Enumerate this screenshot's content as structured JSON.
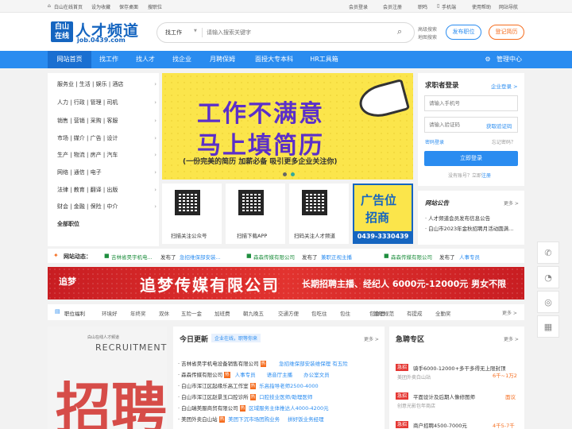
{
  "topbar": {
    "site_link": "白山在线首页",
    "bookmark": "设为收藏",
    "save_desktop": "保存桌面",
    "search_pos": "搜职位",
    "member_login": "会员登录",
    "member_register": "会员注册",
    "recruit": "职鸣",
    "mobile": "手机端",
    "help": "使用帮助",
    "site_nav": "网站导航"
  },
  "header": {
    "logo_top": "白山",
    "logo_bottom": "在线",
    "logo_title": "人才频道",
    "logo_url": "job.0439.com",
    "search_type": "找工作",
    "search_placeholder": "请输入搜索关键字",
    "adv_search": "高级搜索",
    "map_search": "地图搜索",
    "post_job": "发布职位",
    "register_resume": "登记简历"
  },
  "nav": {
    "items": [
      "网站首页",
      "找工作",
      "找人才",
      "找企业",
      "月聘保姆",
      "面授大专本科",
      "HR工具箱"
    ],
    "admin": "管理中心"
  },
  "categories": [
    "服务业 | 生活 | 娱乐 | 酒店",
    "人力 | 行政 | 管理 | 司机",
    "销售 | 营销 | 采购 | 客服",
    "市场 | 媒介 | 广告 | 设计",
    "生产 | 物流 | 房产 | 汽车",
    "网络 | 通信 | 电子",
    "法律 | 教育 | 翻译 | 出版",
    "财会 | 金融 | 保险 | 中介",
    "全部职位"
  ],
  "banner": {
    "line1": "工作不满意",
    "line2": "马上填简历",
    "line3": "(一份完美的简历 加薪必备 吸引更多企业关注你)"
  },
  "qrs": [
    {
      "caption": "扫描关注公众号"
    },
    {
      "caption": "扫描下载APP"
    },
    {
      "caption": "扫码关注人才频道"
    }
  ],
  "ad": {
    "line1": "广告位",
    "line2": "招商",
    "phone": "0439-3330439"
  },
  "login": {
    "title": "求职者登录",
    "company_login": "企业登录 >",
    "phone_placeholder": "请输入手机号",
    "code_placeholder": "请输入验证码",
    "get_code": "获取验证码",
    "password_login": "密码登录",
    "forgot": "忘记密码？",
    "submit": "立即登录",
    "no_account": "没有账号？立即",
    "register": "注册"
  },
  "notice": {
    "title": "网站公告",
    "more": "更多 >",
    "items": [
      "· 人才频道会员发布信息公告",
      "· 白山市2023年金秋招聘月活动圆满..."
    ]
  },
  "dynamics": {
    "label": "网站动态：",
    "items": [
      {
        "company": "吉林省昊宇机电...",
        "job": "急招维保部安装..."
      },
      {
        "company": "森森传媒有限公司",
        "job": "兼职正视主播"
      },
      {
        "company": "森森传媒有限公司",
        "job": "人事专员"
      }
    ],
    "published": "发布了"
  },
  "wide_banner": {
    "brand": "追梦",
    "company": "追梦传媒有限公司",
    "offer": "长期招聘主播、经纪人 6000元-12000元 男女不限"
  },
  "welfare": {
    "label": "职位福利",
    "items": [
      "环境好",
      "年终奖",
      "双休",
      "五险一金",
      "加班费",
      "朝九晚五",
      "交通方便",
      "包吃住",
      "包住",
      "包食宿",
      "管理规范",
      "有提成",
      "全勤奖"
    ],
    "more": "更多 >"
  },
  "promo": {
    "top": "白山在线人才频道",
    "en": "RECRUITMENT",
    "big": "招聘"
  },
  "today": {
    "title": "今日更新",
    "sub": "企业在线，职等你来",
    "more": "更多 >",
    "rows": [
      {
        "company": "吉林省昊宇机电设备销售有限公司",
        "job": "急招维保部安装维保理 有五险"
      },
      {
        "company": "森森传媒有限公司",
        "job": "人事专员",
        "job2": "语音厅主播",
        "job3": "办公室文员"
      },
      {
        "company": "白山市浑江区起缘乐高工作室",
        "job": "乐高指导老师2500-4000"
      },
      {
        "company": "白山市浑江区赵景玉口腔诊所",
        "job": "口腔技业医师/助理医师"
      },
      {
        "company": "白山瑞美服商贸有限公司",
        "job": "区域服务主体推达人4000-4200元"
      },
      {
        "company": "美团外卖白山站",
        "job": "美团下沉市场团购业务",
        "job2": "拼好饭业务经理"
      }
    ]
  },
  "urgent": {
    "title": "急聘专区",
    "more": "更多 >",
    "tag": "急招",
    "rows": [
      {
        "job": "骑手6000-12000+多干多得无上限封顶",
        "company": "美团外卖白山站",
        "salary": "6千~1万2"
      },
      {
        "job": "平面设计及后期人像修图师",
        "company": "创意光影包年商店",
        "salary": "面议"
      },
      {
        "job": "商户招聘4500-7000元",
        "company": "",
        "salary": "4千5-7千"
      }
    ]
  },
  "colors": {
    "accent": "#2a8cf0",
    "banner_bg": "#fbe54b",
    "banner_purple": "#5b2fc9",
    "red": "#e53935",
    "wide_red": "#d8262b"
  }
}
